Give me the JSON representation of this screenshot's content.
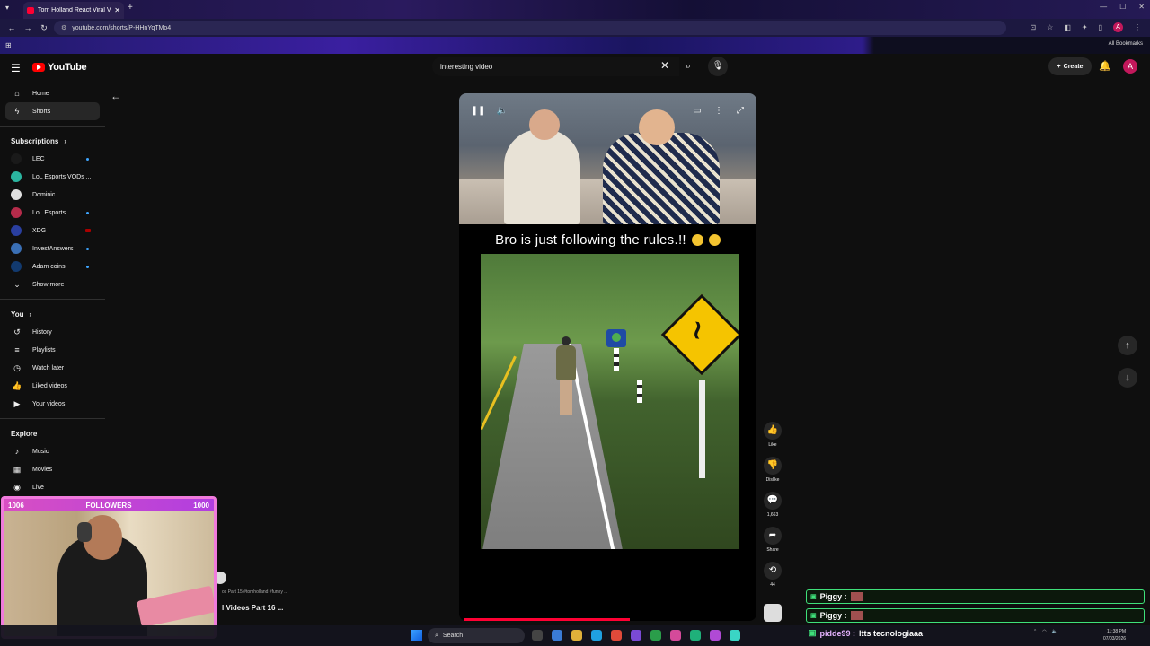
{
  "browser": {
    "tab_title": "Tom Holland React Viral Vi",
    "url": "youtube.com/shorts/P-HHnYqTMo4",
    "all_bookmarks": "All Bookmarks"
  },
  "header": {
    "logo_text": "YouTube",
    "search_value": "interesting video",
    "create_label": "Create",
    "avatar_letter": "A"
  },
  "sidebar": {
    "main": [
      {
        "icon": "⌂",
        "label": "Home"
      },
      {
        "icon": "ϟ",
        "label": "Shorts"
      }
    ],
    "subscriptions_title": "Subscriptions",
    "subscriptions": [
      {
        "label": "LEC",
        "color": "#1a1a1a",
        "indicator": "dot"
      },
      {
        "label": "LoL Esports VODs ...",
        "color": "#2bb5a0",
        "indicator": "none"
      },
      {
        "label": "Dominic",
        "color": "#e0e0e0",
        "indicator": "none"
      },
      {
        "label": "LoL Esports",
        "color": "#b52b4a",
        "indicator": "dot"
      },
      {
        "label": "XDG",
        "color": "#2a3fa0",
        "indicator": "live"
      },
      {
        "label": "InvestAnswers",
        "color": "#3a6fb5",
        "indicator": "dot"
      },
      {
        "label": "Adam coins",
        "color": "#123a6f",
        "indicator": "dot"
      }
    ],
    "show_more": "Show more",
    "you_title": "You",
    "you": [
      {
        "icon": "↺",
        "label": "History"
      },
      {
        "icon": "≡",
        "label": "Playlists"
      },
      {
        "icon": "◷",
        "label": "Watch later"
      },
      {
        "icon": "👍",
        "label": "Liked videos"
      },
      {
        "icon": "▶",
        "label": "Your videos"
      }
    ],
    "explore_title": "Explore",
    "explore": [
      {
        "icon": "♪",
        "label": "Music"
      },
      {
        "icon": "▦",
        "label": "Movies"
      },
      {
        "icon": "◉",
        "label": "Live"
      }
    ]
  },
  "video": {
    "caption": "Bro is just following the rules.!!",
    "progress_fraction": 0.56
  },
  "actions": {
    "like": "Like",
    "dislike": "Dislike",
    "comments": "1,663",
    "share": "Share",
    "remix": "44"
  },
  "webcam": {
    "left_count": "1006",
    "label": "FOLLOWERS",
    "right_count": "1000"
  },
  "behind": {
    "subtitle": "os Part 15 #tomholland #funny ...",
    "title": "l Videos Part 16 ..."
  },
  "chat": [
    {
      "user": "Piggy :",
      "message": ""
    },
    {
      "user": "Piggy :",
      "message": ""
    }
  ],
  "chat_last": {
    "user": "pidde99 :",
    "message": "ltts tecnologiaaa"
  },
  "taskbar": {
    "search": "Search",
    "time": "11:38 PM",
    "date": "07/03/2026"
  }
}
